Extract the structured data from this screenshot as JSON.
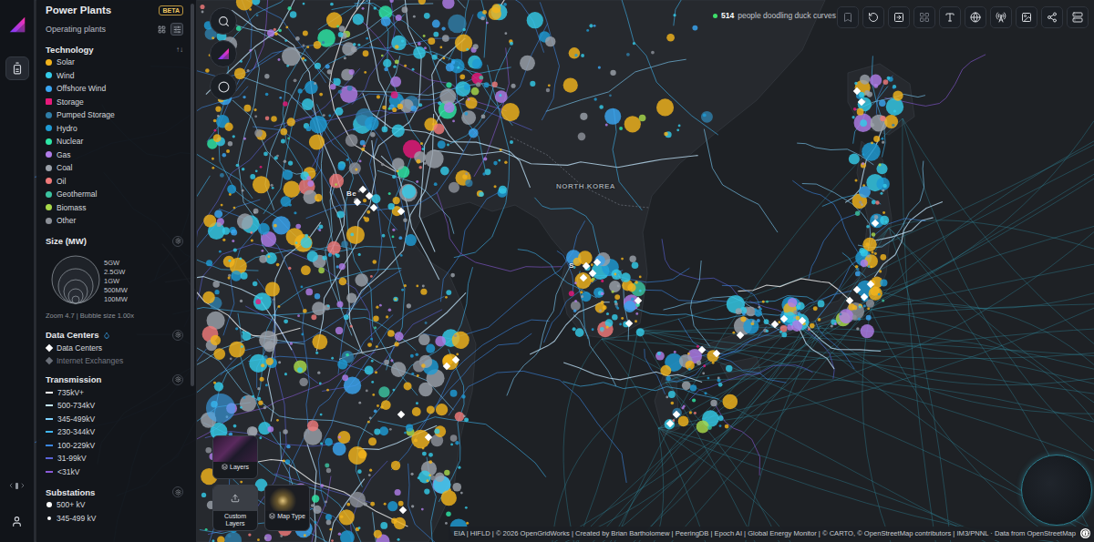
{
  "legend": {
    "title": "Power Plants",
    "badge": "BETA",
    "subtitle": "Operating plants",
    "technology": {
      "title": "Technology",
      "sort": "↑↓",
      "items": [
        {
          "label": "Solar",
          "color": "#f2b31c",
          "kind": "dot"
        },
        {
          "label": "Wind",
          "color": "#35cbe8",
          "kind": "dot"
        },
        {
          "label": "Offshore Wind",
          "color": "#3aa6f2",
          "kind": "dot"
        },
        {
          "label": "Storage",
          "color": "#e6197a",
          "kind": "square"
        },
        {
          "label": "Pumped Storage",
          "color": "#2f7ea8",
          "kind": "dot"
        },
        {
          "label": "Hydro",
          "color": "#1f9bd4",
          "kind": "dot"
        },
        {
          "label": "Nuclear",
          "color": "#2ee6a6",
          "kind": "dot"
        },
        {
          "label": "Gas",
          "color": "#b07ce8",
          "kind": "dot"
        },
        {
          "label": "Coal",
          "color": "#9ba1a9",
          "kind": "dot"
        },
        {
          "label": "Oil",
          "color": "#f07a7a",
          "kind": "dot"
        },
        {
          "label": "Geothermal",
          "color": "#3cc3a0",
          "kind": "dot"
        },
        {
          "label": "Biomass",
          "color": "#a8d94a",
          "kind": "dot"
        },
        {
          "label": "Other",
          "color": "#8c9098",
          "kind": "dot"
        }
      ]
    },
    "size": {
      "title": "Size (MW)",
      "ticks": [
        "5GW",
        "2.5GW",
        "1GW",
        "500MW",
        "100MW"
      ],
      "footer": "Zoom 4.7 | Bubble size 1.00x"
    },
    "data_centers": {
      "title": "Data Centers",
      "items": [
        {
          "label": "Data Centers",
          "enabled": true
        },
        {
          "label": "Internet Exchanges",
          "enabled": false
        }
      ]
    },
    "transmission": {
      "title": "Transmission",
      "items": [
        {
          "label": "735kV+",
          "color": "#ffffff"
        },
        {
          "label": "500-734kV",
          "color": "#c4e8ff"
        },
        {
          "label": "345-499kV",
          "color": "#7fd3ff"
        },
        {
          "label": "230-344kV",
          "color": "#3fb6f0"
        },
        {
          "label": "100-229kV",
          "color": "#3a86e0"
        },
        {
          "label": "31-99kV",
          "color": "#5a63d8"
        },
        {
          "label": "<31kV",
          "color": "#8a5ad8"
        }
      ]
    },
    "substations": {
      "title": "Substations",
      "items": [
        {
          "label": "500+ kV"
        },
        {
          "label": "345-499 kV"
        }
      ]
    }
  },
  "presence": {
    "count": "514",
    "text": "people doodling duck curves"
  },
  "map": {
    "labels": [
      {
        "text": "NORTH KOREA"
      },
      {
        "text": "Be"
      },
      {
        "text": "S"
      }
    ]
  },
  "map_buttons": [
    {
      "label": "Layers"
    },
    {
      "label": "Custom Layers"
    },
    {
      "label": "Map Type"
    }
  ],
  "attribution": "EIA | HIFLD | © 2026 OpenGridWorks | Created by Brian Bartholomew | PeeringDB | Epoch AI | Global Energy Monitor | © CARTO, © OpenStreetMap contributors | IM3/PNNL · Data from OpenStreetMap"
}
